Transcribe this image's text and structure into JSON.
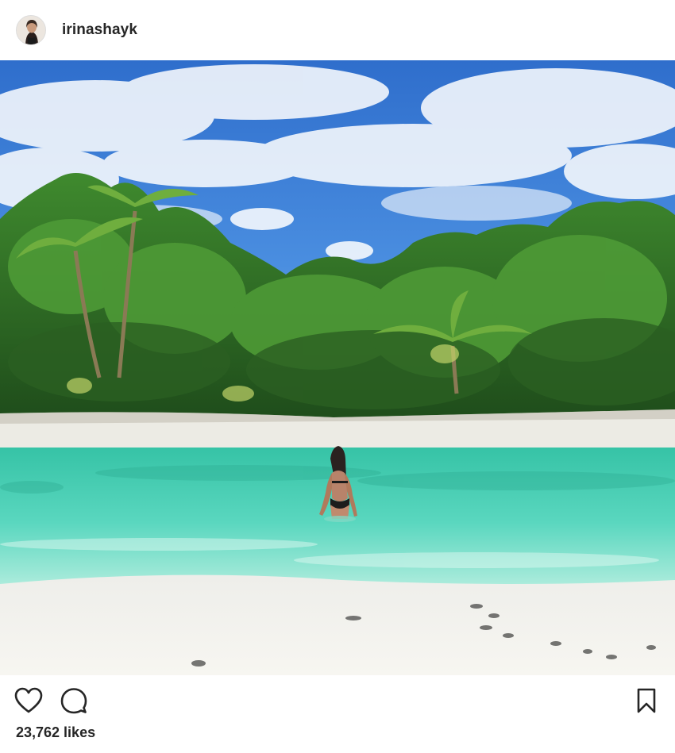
{
  "post": {
    "username": "irinashayk",
    "likes_text": "23,762 likes"
  },
  "icons": {
    "like": "heart-icon",
    "comment": "comment-icon",
    "save": "bookmark-icon"
  },
  "colors": {
    "text": "#262626",
    "sky": "#3f7fd6",
    "water": "#4fd1b8",
    "sand": "#f3f1ea",
    "foliage": "#2f6b2a"
  }
}
